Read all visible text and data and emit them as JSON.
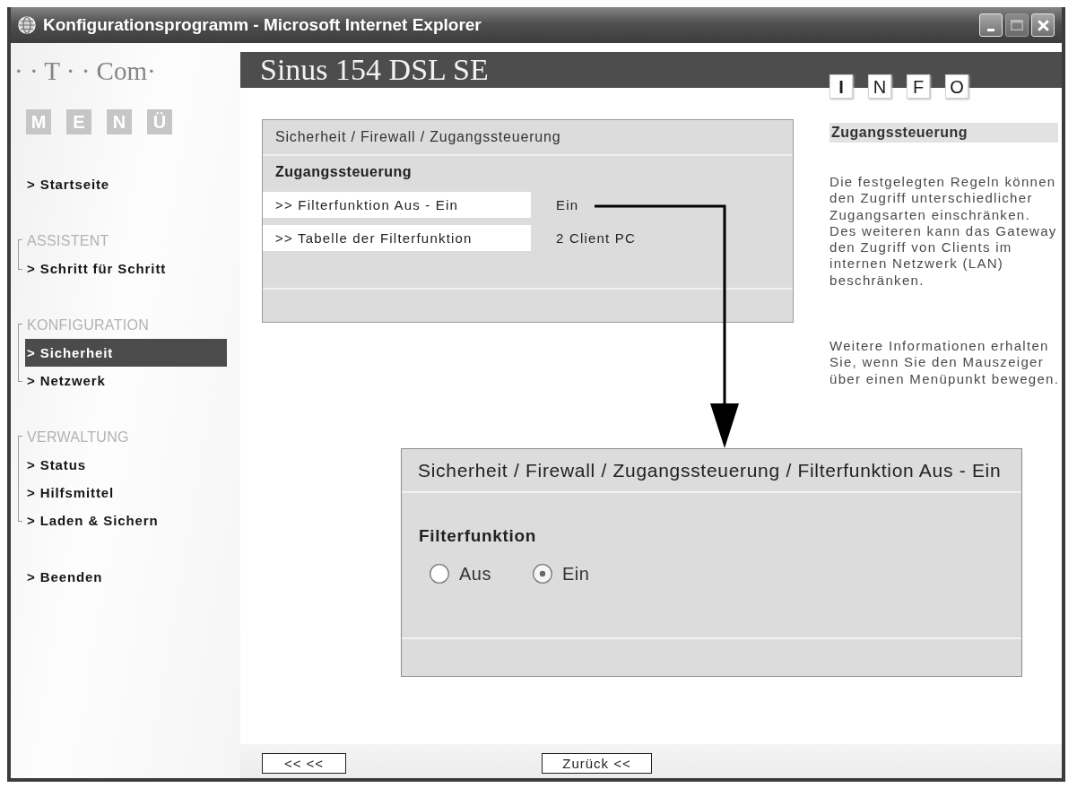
{
  "window": {
    "title": "Konfigurationsprogramm - Microsoft Internet Explorer",
    "controls": [
      {
        "kind": "minimize",
        "disabled": false
      },
      {
        "kind": "maximize",
        "disabled": true
      },
      {
        "kind": "close",
        "disabled": false
      }
    ]
  },
  "logo": {
    "text": "· · T · · Com·"
  },
  "menu_title": [
    "M",
    "E",
    "N",
    "Ü"
  ],
  "sidebar": {
    "sections": [
      {
        "items": [
          {
            "label": "> Startseite",
            "selected": false
          }
        ]
      },
      {
        "title": "ASSISTENT",
        "items": [
          {
            "label": "> Schritt für Schritt",
            "selected": false
          }
        ]
      },
      {
        "title": "KONFIGURATION",
        "items": [
          {
            "label": "> Sicherheit",
            "selected": true
          },
          {
            "label": "> Netzwerk",
            "selected": false
          }
        ]
      },
      {
        "title": "VERWALTUNG",
        "items": [
          {
            "label": "> Status",
            "selected": false
          },
          {
            "label": "> Hilfsmittel",
            "selected": false
          },
          {
            "label": "> Laden & Sichern",
            "selected": false
          }
        ]
      },
      {
        "items": [
          {
            "label": "> Beenden",
            "selected": false
          }
        ]
      }
    ]
  },
  "header": {
    "title": "Sinus 154 DSL SE"
  },
  "info_title": [
    "I",
    "N",
    "F",
    "O"
  ],
  "settings_panel": {
    "breadcrumb": "Sicherheit / Firewall / Zugangssteuerung",
    "heading": "Zugangssteuerung",
    "rows": [
      {
        "label": ">> Filterfunktion Aus - Ein",
        "value": "Ein"
      },
      {
        "label": ">> Tabelle der Filterfunktion",
        "value": "2 Client PC"
      }
    ]
  },
  "info_panel": {
    "title": "Zugangssteuerung",
    "paragraphs": [
      "Die festgelegten Regeln können den Zugriff unterschiedlicher Zugangsarten einschränken. Des weiteren kann das Gateway den Zugriff von Clients im internen Netzwerk (LAN) beschränken.",
      "Weitere Informationen erhalten Sie, wenn Sie den Mauszeiger über einen Menüpunkt bewegen."
    ]
  },
  "detail_panel": {
    "breadcrumb": "Sicherheit / Firewall / Zugangssteuerung / Filterfunktion Aus - Ein",
    "heading": "Filterfunktion",
    "options": [
      {
        "label": "Aus",
        "selected": false
      },
      {
        "label": "Ein",
        "selected": true
      }
    ]
  },
  "buttons": [
    "<< <<",
    "Zurück <<"
  ]
}
